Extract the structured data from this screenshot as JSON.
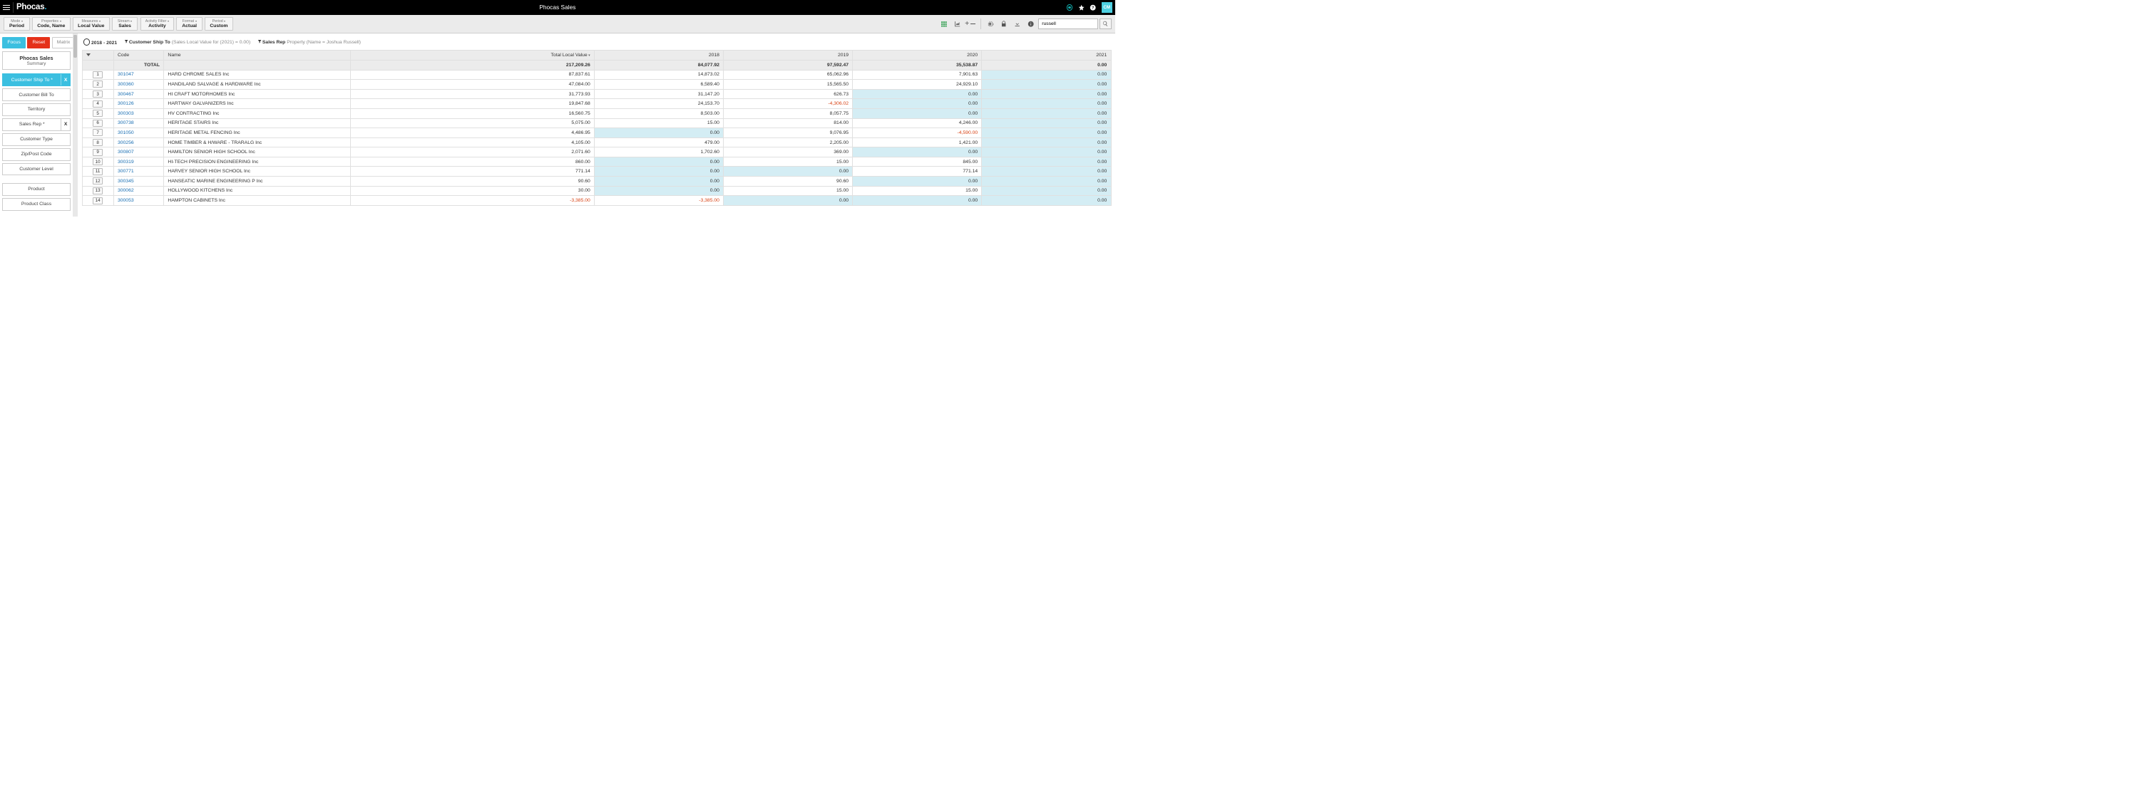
{
  "header": {
    "logo_text": "Phocas",
    "title": "Phocas Sales",
    "avatar_initials": "CM"
  },
  "toolbar": {
    "items": [
      {
        "label": "Mode",
        "value": "Period"
      },
      {
        "label": "Properties",
        "value": "Code, Name"
      },
      {
        "label": "Measures",
        "value": "Local Value"
      },
      {
        "label": "Stream",
        "value": "Sales"
      },
      {
        "label": "Activity Filter",
        "value": "Activity"
      },
      {
        "label": "Format",
        "value": "Actual"
      },
      {
        "label": "Period",
        "value": "Custom"
      }
    ],
    "search_value": "russell"
  },
  "buttons": {
    "focus": "Focus",
    "reset": "Reset",
    "matrix": "Matrix"
  },
  "panel": {
    "title": "Phocas Sales",
    "subtitle": "Summary"
  },
  "sidebar": {
    "items": [
      {
        "label": "Customer Ship To *",
        "active": true,
        "x": true
      },
      {
        "label": "Customer Bill To"
      },
      {
        "label": "Territory"
      },
      {
        "label": "Sales Rep *",
        "x": true
      },
      {
        "label": "Customer Type"
      },
      {
        "label": "Zip/Post Code"
      },
      {
        "label": "Customer Level"
      }
    ],
    "items2": [
      {
        "label": "Product"
      },
      {
        "label": "Product Class"
      }
    ]
  },
  "filters": {
    "period": "2018 - 2021",
    "f1_label": "Customer Ship To",
    "f1_detail": "(Sales Local Value for (2021) = 0.00)",
    "f2_label": "Sales Rep",
    "f2_prop": "Property",
    "f2_detail": "(Name = Joshua Russell)"
  },
  "table": {
    "headers": {
      "code": "Code",
      "name": "Name",
      "total": "Total Local Value",
      "y1": "2018",
      "y2": "2019",
      "y3": "2020",
      "y4": "2021"
    },
    "total_label": "TOTAL",
    "totals": {
      "total": "217,209.26",
      "y1": "84,077.92",
      "y2": "97,592.47",
      "y3": "35,538.87",
      "y4": "0.00"
    },
    "rows": [
      {
        "n": "1",
        "code": "301047",
        "name": "HARD CHROME SALES Inc",
        "total": "87,837.61",
        "y1": "14,873.02",
        "y2": "65,062.96",
        "y3": "7,901.63",
        "y4": "0.00"
      },
      {
        "n": "2",
        "code": "300360",
        "name": "HANDILAND SALVAGE & HARDWARE Inc",
        "total": "47,084.00",
        "y1": "6,589.40",
        "y2": "15,565.50",
        "y3": "24,929.10",
        "y4": "0.00"
      },
      {
        "n": "3",
        "code": "300467",
        "name": "HI CRAFT MOTORHOMES Inc",
        "total": "31,773.93",
        "y1": "31,147.20",
        "y2": "626.73",
        "y3": "0.00",
        "y3_hl": true,
        "y4": "0.00"
      },
      {
        "n": "4",
        "code": "300126",
        "name": "HARTWAY GALVANIZERS Inc",
        "total": "19,847.68",
        "y1": "24,153.70",
        "y2": "-4,306.02",
        "y2_neg": true,
        "y3": "0.00",
        "y3_hl": true,
        "y4": "0.00"
      },
      {
        "n": "5",
        "code": "300303",
        "name": "HV CONTRACTING Inc",
        "total": "16,560.75",
        "y1": "8,503.00",
        "y2": "8,057.75",
        "y3": "0.00",
        "y3_hl": true,
        "y4": "0.00"
      },
      {
        "n": "6",
        "code": "300738",
        "name": "HERITAGE STAIRS Inc",
        "total": "5,075.00",
        "y1": "15.00",
        "y2": "814.00",
        "y3": "4,246.00",
        "y4": "0.00"
      },
      {
        "n": "7",
        "code": "301050",
        "name": "HERITAGE METAL FENCING Inc",
        "total": "4,486.95",
        "y1": "0.00",
        "y1_hl": true,
        "y2": "9,076.95",
        "y3": "-4,590.00",
        "y3_neg": true,
        "y4": "0.00"
      },
      {
        "n": "8",
        "code": "300256",
        "name": "HOME TIMBER & H/WARE - TRARALG Inc",
        "total": "4,105.00",
        "y1": "479.00",
        "y2": "2,205.00",
        "y3": "1,421.00",
        "y4": "0.00"
      },
      {
        "n": "9",
        "code": "300807",
        "name": "HAMILTON SENIOR HIGH SCHOOL Inc",
        "total": "2,071.60",
        "y1": "1,702.60",
        "y2": "369.00",
        "y3": "0.00",
        "y3_hl": true,
        "y4": "0.00"
      },
      {
        "n": "10",
        "code": "300319",
        "name": "HI-TECH PRECISION ENGINEERING Inc",
        "total": "860.00",
        "y1": "0.00",
        "y1_hl": true,
        "y2": "15.00",
        "y3": "845.00",
        "y4": "0.00"
      },
      {
        "n": "11",
        "code": "300771",
        "name": "HARVEY SENIOR HIGH SCHOOL Inc",
        "total": "771.14",
        "y1": "0.00",
        "y1_hl": true,
        "y2": "0.00",
        "y2_hl": true,
        "y3": "771.14",
        "y4": "0.00"
      },
      {
        "n": "12",
        "code": "300345",
        "name": "HANSEATIC MARINE ENGINEERING P Inc",
        "total": "90.60",
        "y1": "0.00",
        "y1_hl": true,
        "y2": "90.60",
        "y3": "0.00",
        "y3_hl": true,
        "y4": "0.00"
      },
      {
        "n": "13",
        "code": "300062",
        "name": "HOLLYWOOD KITCHENS Inc",
        "total": "30.00",
        "y1": "0.00",
        "y1_hl": true,
        "y2": "15.00",
        "y3": "15.00",
        "y4": "0.00"
      },
      {
        "n": "14",
        "code": "300053",
        "name": "HAMPTON CABINETS Inc",
        "total": "-3,385.00",
        "total_neg": true,
        "y1": "-3,385.00",
        "y1_neg": true,
        "y2": "0.00",
        "y2_hl": true,
        "y3": "0.00",
        "y3_hl": true,
        "y4": "0.00"
      }
    ]
  }
}
